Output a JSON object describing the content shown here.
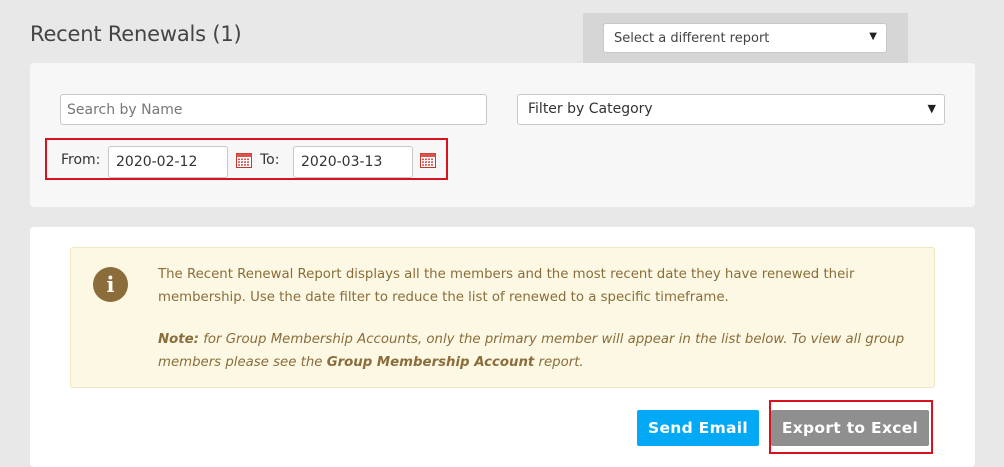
{
  "page": {
    "title": "Recent Renewals (1)"
  },
  "report_selector": {
    "label": "Select a different report"
  },
  "filters": {
    "search_placeholder": "Search by Name",
    "search_value": "",
    "category_label": "Filter by Category",
    "from_label": "From:",
    "from_value": "2020-02-12",
    "to_label": "To:",
    "to_value": "2020-03-13"
  },
  "info": {
    "description": "The Recent Renewal Report displays all the members and the most recent date they have renewed their membership. Use the date filter to reduce the list of renewed to a specific timeframe.",
    "note_label": "Note:",
    "note_text_1": " for Group Membership Accounts, only the primary member will appear in the list below. To view all group members please see the ",
    "note_bold": "Group Membership Account",
    "note_text_2": " report."
  },
  "actions": {
    "send_email": "Send Email",
    "export_excel": "Export to Excel"
  },
  "colors": {
    "email_button": "#03a9f4",
    "excel_button": "#8f8f8f",
    "highlight": "#d9121f",
    "info_background": "#fcf8e3",
    "info_text": "#8a6d3b"
  },
  "icons": {
    "info": "info-icon",
    "calendar": "calendar-icon",
    "dropdown": "chevron-down-icon"
  }
}
